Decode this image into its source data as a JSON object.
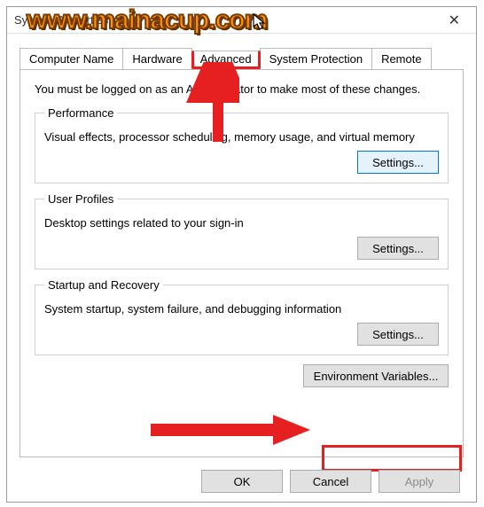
{
  "window": {
    "title": "System Properties"
  },
  "watermark": "www.mainacup.com",
  "tabs": {
    "t0": "Computer Name",
    "t1": "Hardware",
    "t2": "Advanced",
    "t3": "System Protection",
    "t4": "Remote"
  },
  "intro": "You must be logged on as an Administrator to make most of these changes.",
  "groups": {
    "perf": {
      "legend": "Performance",
      "text": "Visual effects, processor scheduling, memory usage, and virtual memory",
      "btn": "Settings..."
    },
    "profiles": {
      "legend": "User Profiles",
      "text": "Desktop settings related to your sign-in",
      "btn": "Settings..."
    },
    "startup": {
      "legend": "Startup and Recovery",
      "text": "System startup, system failure, and debugging information",
      "btn": "Settings..."
    }
  },
  "env_btn": "Environment Variables...",
  "buttons": {
    "ok": "OK",
    "cancel": "Cancel",
    "apply": "Apply"
  }
}
